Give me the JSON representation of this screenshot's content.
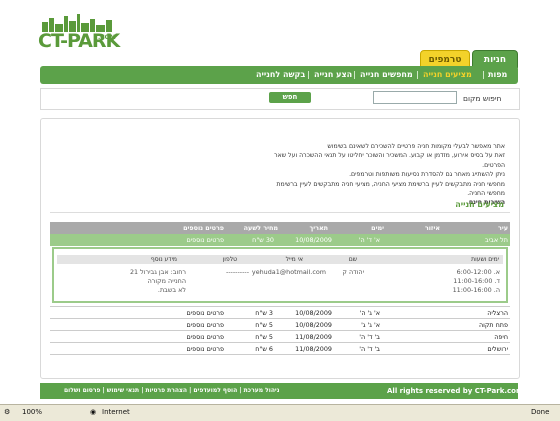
{
  "logo": {
    "text": "CT-PARK",
    "domain": ".COM"
  },
  "tabs": [
    {
      "label": "חניות",
      "color": "#5ca24a"
    },
    {
      "label": "טרמפים",
      "color": "#f3d22a"
    }
  ],
  "nav": {
    "items": [
      {
        "label": "מפות"
      },
      {
        "label": "מציעים חנייה",
        "active": true
      },
      {
        "label": "מחפשים חנייה"
      },
      {
        "label": "הצע חנייה"
      },
      {
        "label": "בקשה לחנייה"
      }
    ]
  },
  "search": {
    "label": "חיפוש מקום",
    "value": "",
    "button": "חפש"
  },
  "intro": {
    "lines": [
      "אתר מאפשר לבעלי מקומות חניה פרטיים להשכירם לשאינם בשימוש",
      "זאת על בסיס אירוע, מזדמן או קבוע. המשכיר והשוכר יחליטו על תנאי ההשכרה ועל שאר הפרטים.",
      "ניתן להשתייג מאחר גם להסדרת נסיעות משותפות וטרמפים.",
      "מחפשי חניה מתבקשים לעיין ברשימת מציעי החניה, מציעי חניה מתבקשים לעיין ברשימת מחפשי החניה."
    ],
    "bold": "השירות חינם."
  },
  "section": {
    "title": "מציעים חנייה"
  },
  "table": {
    "headers": [
      "עיר",
      "איזור",
      "ימים",
      "תאריך",
      "מחיר לשעה",
      "פרטים נוספים"
    ],
    "selected": {
      "city": "תל אביב",
      "days": "א' ד' ה'",
      "date": "10/08/2009",
      "price": "30 ש\"ח",
      "more": "פרטים נוספים"
    },
    "detail": {
      "headers": [
        "ימים ושעות",
        "שם",
        "אי מייל",
        "טלפון",
        "מידע נוסף"
      ],
      "hours": [
        "א. 6:00-12:00",
        "ד. 11:00-16:00",
        "ה. 11:00-16:00"
      ],
      "name": "יהודה ק",
      "email": "yehuda1@hotmail.com",
      "phone": "----------",
      "info": [
        "רחוב: אבן גבירול 21",
        "החנייה מקורה",
        "לא בשבת."
      ]
    },
    "rows": [
      {
        "city": "הרצליה",
        "days": "א' ג' ה'",
        "date": "10/08/2009",
        "price": "3 ש\"ח",
        "more": "פרטים נוספים"
      },
      {
        "city": "פתח תקוה",
        "days": "א' ג' ג'",
        "date": "10/08/2009",
        "price": "5 ש\"ח",
        "more": "פרטים נוספים"
      },
      {
        "city": "חיפה",
        "days": "ב' ד' ה'",
        "date": "11/08/2009",
        "price": "5 ש\"ח",
        "more": "פרטים נוספים"
      },
      {
        "city": "ירושלים",
        "days": "ב' ד' ה'",
        "date": "11/08/2009",
        "price": "6 ש\"ח",
        "more": "פרטים נוספים"
      }
    ]
  },
  "footer": {
    "rights": "All rights reserved by CT-Park.com",
    "links": "ניהול מערכת | הוסף למועדפים | הצהרת פרטיות | תנאי שימוש | פרסום ושלום"
  },
  "statusbar": {
    "zoom": "100%",
    "zone": "Internet",
    "done": "Done"
  }
}
